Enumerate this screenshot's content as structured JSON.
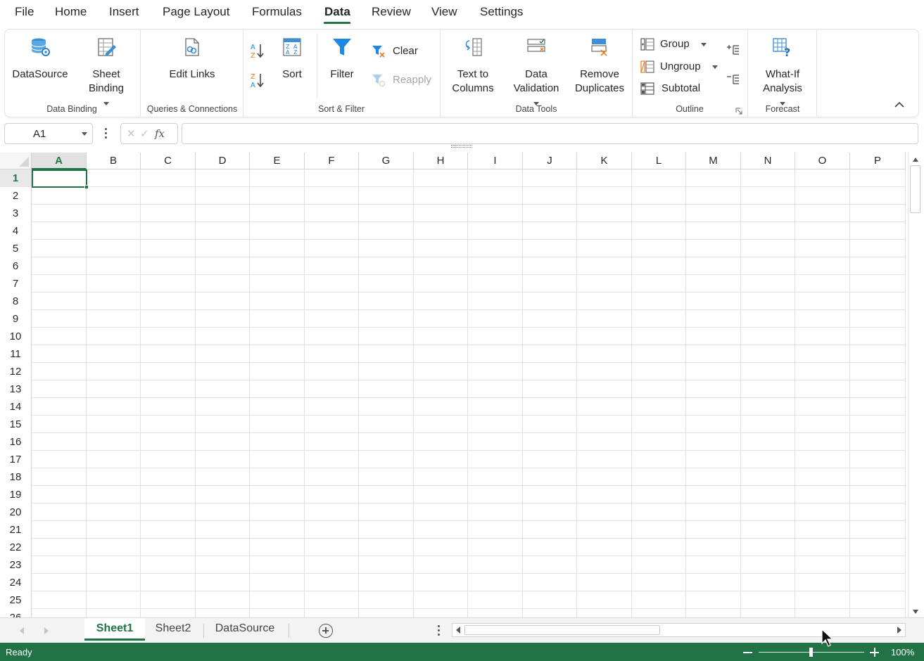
{
  "menu": {
    "items": [
      "File",
      "Home",
      "Insert",
      "Page Layout",
      "Formulas",
      "Data",
      "Review",
      "View",
      "Settings"
    ],
    "active": "Data"
  },
  "ribbon": {
    "groups": {
      "data_binding": "Data Binding",
      "queries": "Queries & Connections",
      "sort_filter": "Sort & Filter",
      "data_tools": "Data Tools",
      "outline": "Outline",
      "forecast": "Forecast"
    },
    "buttons": {
      "datasource": "DataSource",
      "sheet_binding_1": "Sheet",
      "sheet_binding_2": "Binding",
      "edit_links": "Edit Links",
      "sort": "Sort",
      "filter": "Filter",
      "clear": "Clear",
      "reapply": "Reapply",
      "text_to_columns_1": "Text to",
      "text_to_columns_2": "Columns",
      "data_validation_1": "Data",
      "data_validation_2": "Validation",
      "remove_duplicates_1": "Remove",
      "remove_duplicates_2": "Duplicates",
      "group": "Group",
      "ungroup": "Ungroup",
      "subtotal": "Subtotal",
      "what_if_1": "What-If",
      "what_if_2": "Analysis"
    }
  },
  "formula_bar": {
    "name_box": "A1",
    "fx": "fx",
    "formula": ""
  },
  "grid": {
    "columns": [
      "A",
      "B",
      "C",
      "D",
      "E",
      "F",
      "G",
      "H",
      "I",
      "J",
      "K",
      "L",
      "M",
      "N",
      "O",
      "P"
    ],
    "rows": [
      "1",
      "2",
      "3",
      "4",
      "5",
      "6",
      "7",
      "8",
      "9",
      "10",
      "11",
      "12",
      "13",
      "14",
      "15",
      "16",
      "17",
      "18",
      "19",
      "20",
      "21",
      "22",
      "23",
      "24",
      "25",
      "26"
    ],
    "selected_column": "A",
    "selected_row": "1"
  },
  "sheets": {
    "tabs": [
      "Sheet1",
      "Sheet2",
      "DataSource"
    ],
    "active": "Sheet1"
  },
  "status": {
    "text": "Ready",
    "zoom": "100%"
  },
  "colors": {
    "accent": "#217346",
    "filter_blue": "#1e88e5"
  }
}
